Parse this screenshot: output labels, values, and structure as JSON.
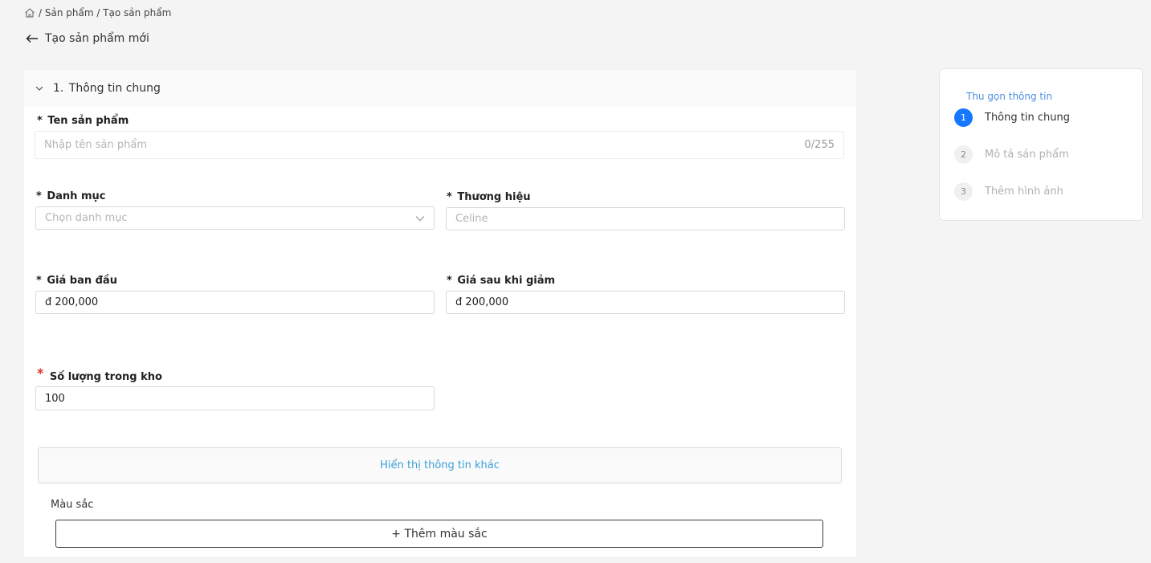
{
  "breadcrumb": {
    "home_icon": "home-icon",
    "path": "/ Sản phẩm / Tạo sản phẩm"
  },
  "header": {
    "back_icon": "arrow-left-icon",
    "title": "Tạo sản phẩm mới"
  },
  "section": {
    "number": "1.",
    "title": "Thông tin chung"
  },
  "form": {
    "product_name": {
      "required_mark": "*",
      "label": "Ten sản phẩm",
      "placeholder": "Nhập tên sản phẩm",
      "value": "",
      "counter": "0/255"
    },
    "category": {
      "required_mark": "*",
      "label": "Danh mục",
      "placeholder": "Chọn danh mục"
    },
    "brand": {
      "required_mark": "*",
      "label": "Thương hiệu",
      "placeholder": "Celine"
    },
    "original_price": {
      "required_mark": "*",
      "label": "Giá ban đầu",
      "value": "đ 200,000"
    },
    "sale_price": {
      "required_mark": "*",
      "label": "Giá sau khi giảm",
      "value": "đ 200,000"
    },
    "stock": {
      "required_mark": "*",
      "label": "Số lượng trong kho",
      "value": "100"
    },
    "more_info_button": "Hiển thị thông tin khác",
    "color_label": "Màu sắc",
    "add_color_button": "+ Thêm màu sắc"
  },
  "steps": {
    "collapse_link": "Thu gọn thông tin",
    "items": [
      {
        "number": "1",
        "label": "Thông tin chung",
        "active": true
      },
      {
        "number": "2",
        "label": "Mô tả sản phẩm",
        "active": false
      },
      {
        "number": "3",
        "label": "Thêm hình ảnh",
        "active": false
      }
    ]
  },
  "colors": {
    "accent": "#1677ff",
    "link": "#3aa0d8",
    "required": "#e03131"
  }
}
